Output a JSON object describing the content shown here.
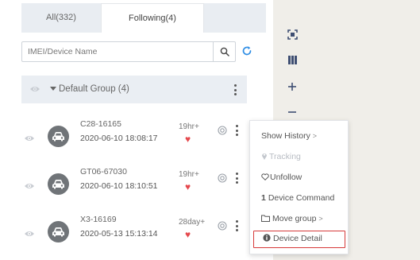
{
  "tabs": [
    {
      "label": "All(332)"
    },
    {
      "label": "Following(4)"
    }
  ],
  "search": {
    "placeholder": "IMEI/Device Name"
  },
  "group": {
    "label": "Default Group (4)"
  },
  "devices": [
    {
      "name": "C28-16165",
      "timestamp": "2020-06-10 18:08:17",
      "duration": "19hr+"
    },
    {
      "name": "GT06-67030",
      "timestamp": "2020-06-10 18:10:51",
      "duration": "19hr+"
    },
    {
      "name": "X3-16169",
      "timestamp": "2020-05-13 15:13:14",
      "duration": "28day+"
    }
  ],
  "context_menu": {
    "items": [
      {
        "label": "Show History",
        "suffix": ">",
        "disabled": false
      },
      {
        "label": "Tracking",
        "disabled": true
      },
      {
        "label": "Unfollow",
        "disabled": false
      },
      {
        "label": "Device Command",
        "disabled": false
      },
      {
        "label": "Move group",
        "suffix": ">",
        "disabled": false
      },
      {
        "label": "Device Detail",
        "highlighted": true,
        "disabled": false
      }
    ]
  },
  "map_controls": [
    "fullscreen-icon",
    "layers-icon",
    "zoom-in-icon",
    "zoom-out-icon"
  ],
  "colors": {
    "accent_blue": "#2f8ee5",
    "heart_red": "#e5484d",
    "highlight_border": "#d63a3a",
    "panel_tab_bg": "#e9edf2",
    "group_bg": "#eaeef3",
    "map_bg": "#f0eee9",
    "map_icon": "#3e4e72"
  }
}
